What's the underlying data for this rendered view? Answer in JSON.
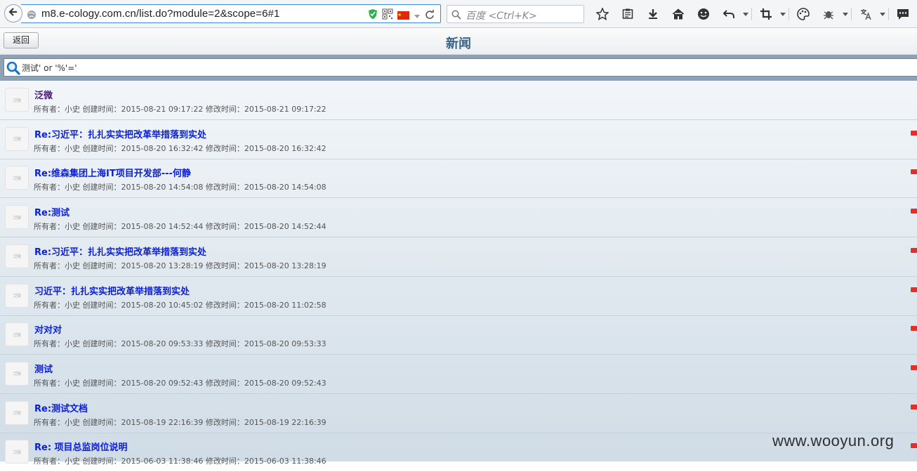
{
  "browser": {
    "url": "m8.e-cology.com.cn/list.do?module=2&scope=6#1",
    "search_placeholder": "百度 <Ctrl+K>"
  },
  "app": {
    "back_label": "返回",
    "title": "新闻",
    "search_value": "测试' or '%'='"
  },
  "items": [
    {
      "title": "泛微",
      "meta": "所有者：小史 创建时间：2015-08-21 09:17:22 修改时间：2015-08-21 09:17:22",
      "is_new": false,
      "visited": true
    },
    {
      "title": "Re:习近平：扎扎实实把改革举措落到实处",
      "meta": "所有者：小史 创建时间：2015-08-20 16:32:42 修改时间：2015-08-20 16:32:42",
      "is_new": true,
      "visited": false
    },
    {
      "title": "Re:维森集团上海IT项目开发部---何静",
      "meta": "所有者：小史 创建时间：2015-08-20 14:54:08 修改时间：2015-08-20 14:54:08",
      "is_new": true,
      "visited": false
    },
    {
      "title": "Re:测试",
      "meta": "所有者：小史 创建时间：2015-08-20 14:52:44 修改时间：2015-08-20 14:52:44",
      "is_new": true,
      "visited": false
    },
    {
      "title": "Re:习近平：扎扎实实把改革举措落到实处",
      "meta": "所有者：小史 创建时间：2015-08-20 13:28:19 修改时间：2015-08-20 13:28:19",
      "is_new": true,
      "visited": false
    },
    {
      "title": "习近平：扎扎实实把改革举措落到实处",
      "meta": "所有者：小史 创建时间：2015-08-20 10:45:02 修改时间：2015-08-20 11:02:58",
      "is_new": true,
      "visited": false
    },
    {
      "title": "对对对",
      "meta": "所有者：小史 创建时间：2015-08-20 09:53:33 修改时间：2015-08-20 09:53:33",
      "is_new": true,
      "visited": false
    },
    {
      "title": "测试",
      "meta": "所有者：小史 创建时间：2015-08-20 09:52:43 修改时间：2015-08-20 09:52:43",
      "is_new": true,
      "visited": false
    },
    {
      "title": "Re:测试文档",
      "meta": "所有者：小史 创建时间：2015-08-19 22:16:39 修改时间：2015-08-19 22:16:39",
      "is_new": true,
      "visited": false
    },
    {
      "title": "Re: 项目总监岗位说明",
      "meta": "所有者：小史 创建时间：2015-06-03 11:38:46 修改时间：2015-06-03 11:38:46",
      "is_new": true,
      "visited": false
    }
  ],
  "avatar_text": "泛微",
  "watermark": "www.wooyun.org",
  "colors": {
    "link": "#0a1fd6",
    "visited": "#4a1a7a",
    "title": "#3a6389",
    "badge": "#e0302a"
  }
}
